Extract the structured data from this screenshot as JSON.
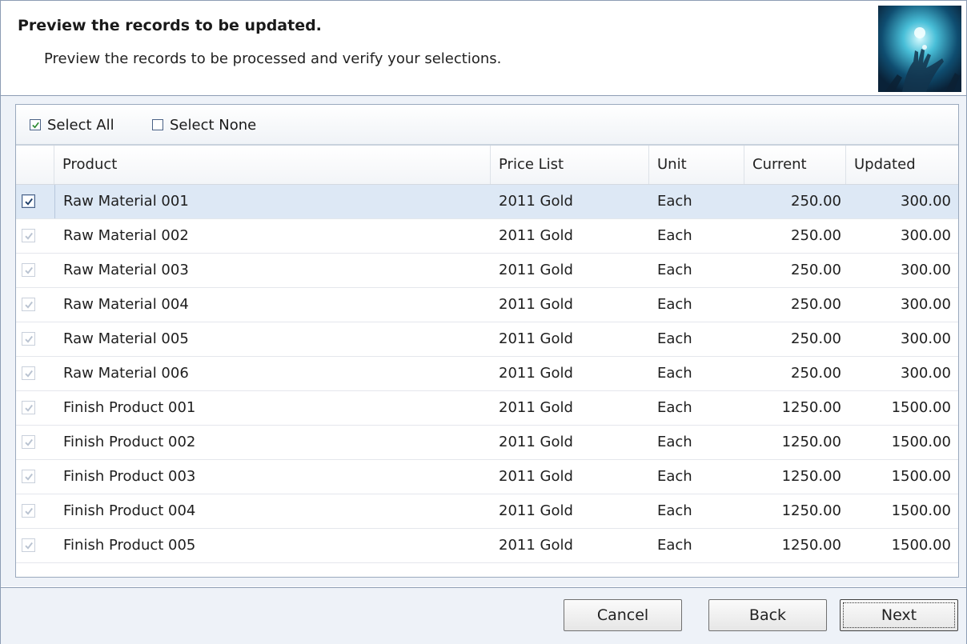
{
  "header": {
    "title": "Preview the records to be updated.",
    "subtitle": "Preview the records to be processed and verify your selections."
  },
  "selection": {
    "select_all_label": "Select All",
    "select_all_checked": true,
    "select_none_label": "Select None",
    "select_none_checked": false
  },
  "grid": {
    "columns": [
      "Product",
      "Price List",
      "Unit",
      "Current",
      "Updated"
    ],
    "rows": [
      {
        "checked": true,
        "selected": true,
        "product": "Raw Material 001",
        "price_list": "2011 Gold",
        "unit": "Each",
        "current": "250.00",
        "updated": "300.00"
      },
      {
        "checked": true,
        "selected": false,
        "product": "Raw Material 002",
        "price_list": "2011 Gold",
        "unit": "Each",
        "current": "250.00",
        "updated": "300.00"
      },
      {
        "checked": true,
        "selected": false,
        "product": "Raw Material 003",
        "price_list": "2011 Gold",
        "unit": "Each",
        "current": "250.00",
        "updated": "300.00"
      },
      {
        "checked": true,
        "selected": false,
        "product": "Raw Material 004",
        "price_list": "2011 Gold",
        "unit": "Each",
        "current": "250.00",
        "updated": "300.00"
      },
      {
        "checked": true,
        "selected": false,
        "product": "Raw Material 005",
        "price_list": "2011 Gold",
        "unit": "Each",
        "current": "250.00",
        "updated": "300.00"
      },
      {
        "checked": true,
        "selected": false,
        "product": "Raw Material 006",
        "price_list": "2011 Gold",
        "unit": "Each",
        "current": "250.00",
        "updated": "300.00"
      },
      {
        "checked": true,
        "selected": false,
        "product": "Finish Product 001",
        "price_list": "2011 Gold",
        "unit": "Each",
        "current": "1250.00",
        "updated": "1500.00"
      },
      {
        "checked": true,
        "selected": false,
        "product": "Finish Product 002",
        "price_list": "2011 Gold",
        "unit": "Each",
        "current": "1250.00",
        "updated": "1500.00"
      },
      {
        "checked": true,
        "selected": false,
        "product": "Finish Product 003",
        "price_list": "2011 Gold",
        "unit": "Each",
        "current": "1250.00",
        "updated": "1500.00"
      },
      {
        "checked": true,
        "selected": false,
        "product": "Finish Product 004",
        "price_list": "2011 Gold",
        "unit": "Each",
        "current": "1250.00",
        "updated": "1500.00"
      },
      {
        "checked": true,
        "selected": false,
        "product": "Finish Product 005",
        "price_list": "2011 Gold",
        "unit": "Each",
        "current": "1250.00",
        "updated": "1500.00"
      }
    ]
  },
  "footer": {
    "cancel_label": "Cancel",
    "back_label": "Back",
    "next_label": "Next"
  },
  "colors": {
    "border": "#8d9db4",
    "panel_bg": "#eef2f8",
    "selected_row": "#dde8f5",
    "check_active": "#21416b",
    "check_inactive": "#b9c3d1"
  },
  "icons": {
    "wizard_image": "hand-with-light-icon",
    "row_check": "checkbox-icon"
  }
}
